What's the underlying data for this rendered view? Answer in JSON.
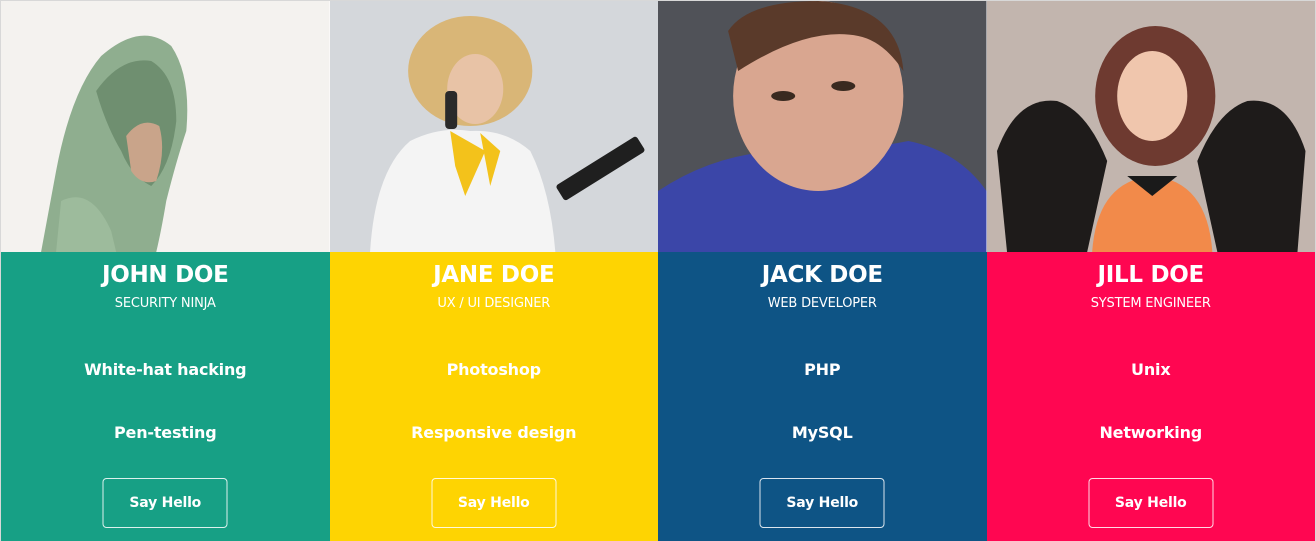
{
  "members": [
    {
      "name": "JOHN DOE",
      "role": "SECURITY NINJA",
      "skills": [
        "White-hat hacking",
        "Pen-testing"
      ],
      "button_label": "Say Hello",
      "color": "#17a085",
      "photo_bg": "#f3f1ee"
    },
    {
      "name": "JANE DOE",
      "role": "UX / UI DESIGNER",
      "skills": [
        "Photoshop",
        "Responsive design"
      ],
      "button_label": "Say Hello",
      "color": "#fed402",
      "photo_bg": "#d6d8dc"
    },
    {
      "name": "JACK DOE",
      "role": "WEB DEVELOPER",
      "skills": [
        "PHP",
        "MySQL"
      ],
      "button_label": "Say Hello",
      "color": "#0e5485",
      "photo_bg": "#4a4c52"
    },
    {
      "name": "JILL DOE",
      "role": "SYSTEM ENGINEER",
      "skills": [
        "Unix",
        "Networking"
      ],
      "button_label": "Say Hello",
      "color": "#ff0651",
      "photo_bg": "#b9aea8"
    }
  ]
}
